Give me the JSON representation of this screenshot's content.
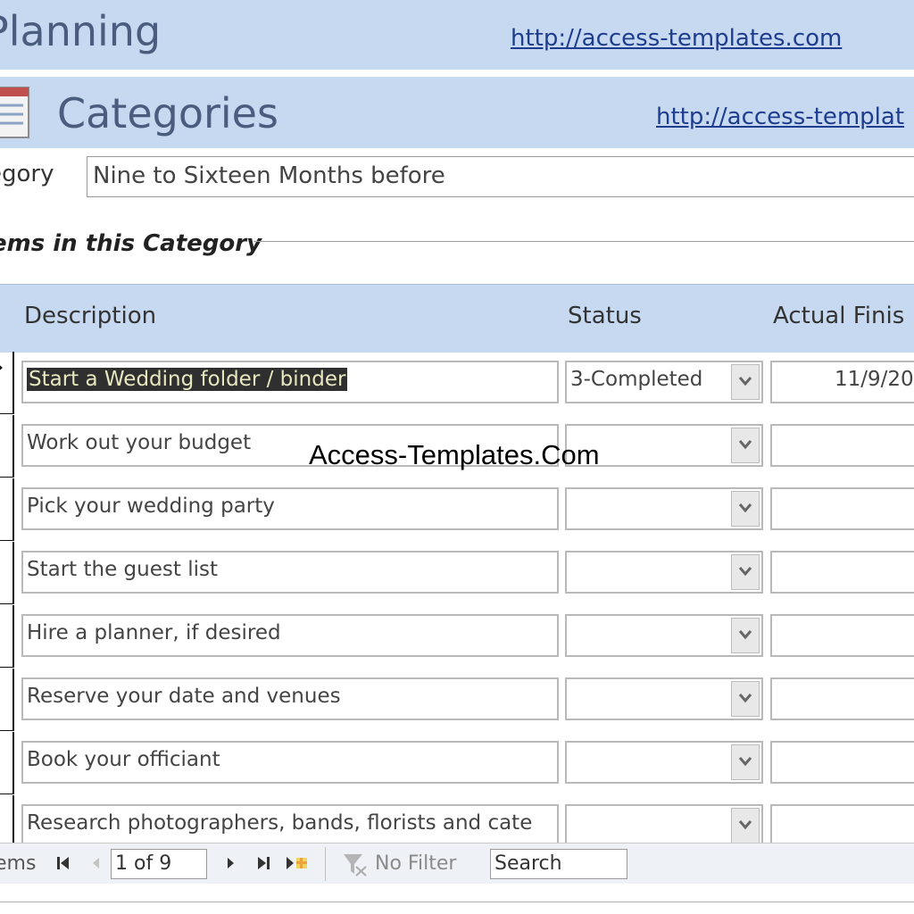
{
  "app": {
    "title": "Planning",
    "link": "http://access-templates.com"
  },
  "form": {
    "title": "Categories",
    "link": "http://access-templat",
    "icon": "form-icon"
  },
  "category": {
    "label": "egory",
    "value": "Nine to Sixteen Months before"
  },
  "section": {
    "label": "ems in this Category"
  },
  "grid": {
    "columns": {
      "description": "Description",
      "status": "Status",
      "actual_finish": "Actual Finis"
    },
    "rows": [
      {
        "description": "Start a Wedding folder / binder",
        "status": "3-Completed",
        "actual_finish": "11/9/20",
        "current": true
      },
      {
        "description": "Work out your budget",
        "status": "",
        "actual_finish": ""
      },
      {
        "description": "Pick your wedding party",
        "status": "",
        "actual_finish": ""
      },
      {
        "description": "Start the guest list",
        "status": "",
        "actual_finish": ""
      },
      {
        "description": "Hire a planner, if desired",
        "status": "",
        "actual_finish": ""
      },
      {
        "description": "Reserve your date and venues",
        "status": "",
        "actual_finish": ""
      },
      {
        "description": "Book your officiant",
        "status": "",
        "actual_finish": ""
      },
      {
        "description": "Research photographers, bands, florists and cate",
        "status": "",
        "actual_finish": ""
      }
    ]
  },
  "watermark": "Access-Templates.Com",
  "navigation": {
    "label": "ems",
    "record": "1 of 9",
    "filter": "No Filter",
    "search": "Search"
  },
  "colors": {
    "header_band": "#c6d9f1",
    "title_text": "#4a5d7e",
    "link": "#1f3d8f"
  }
}
